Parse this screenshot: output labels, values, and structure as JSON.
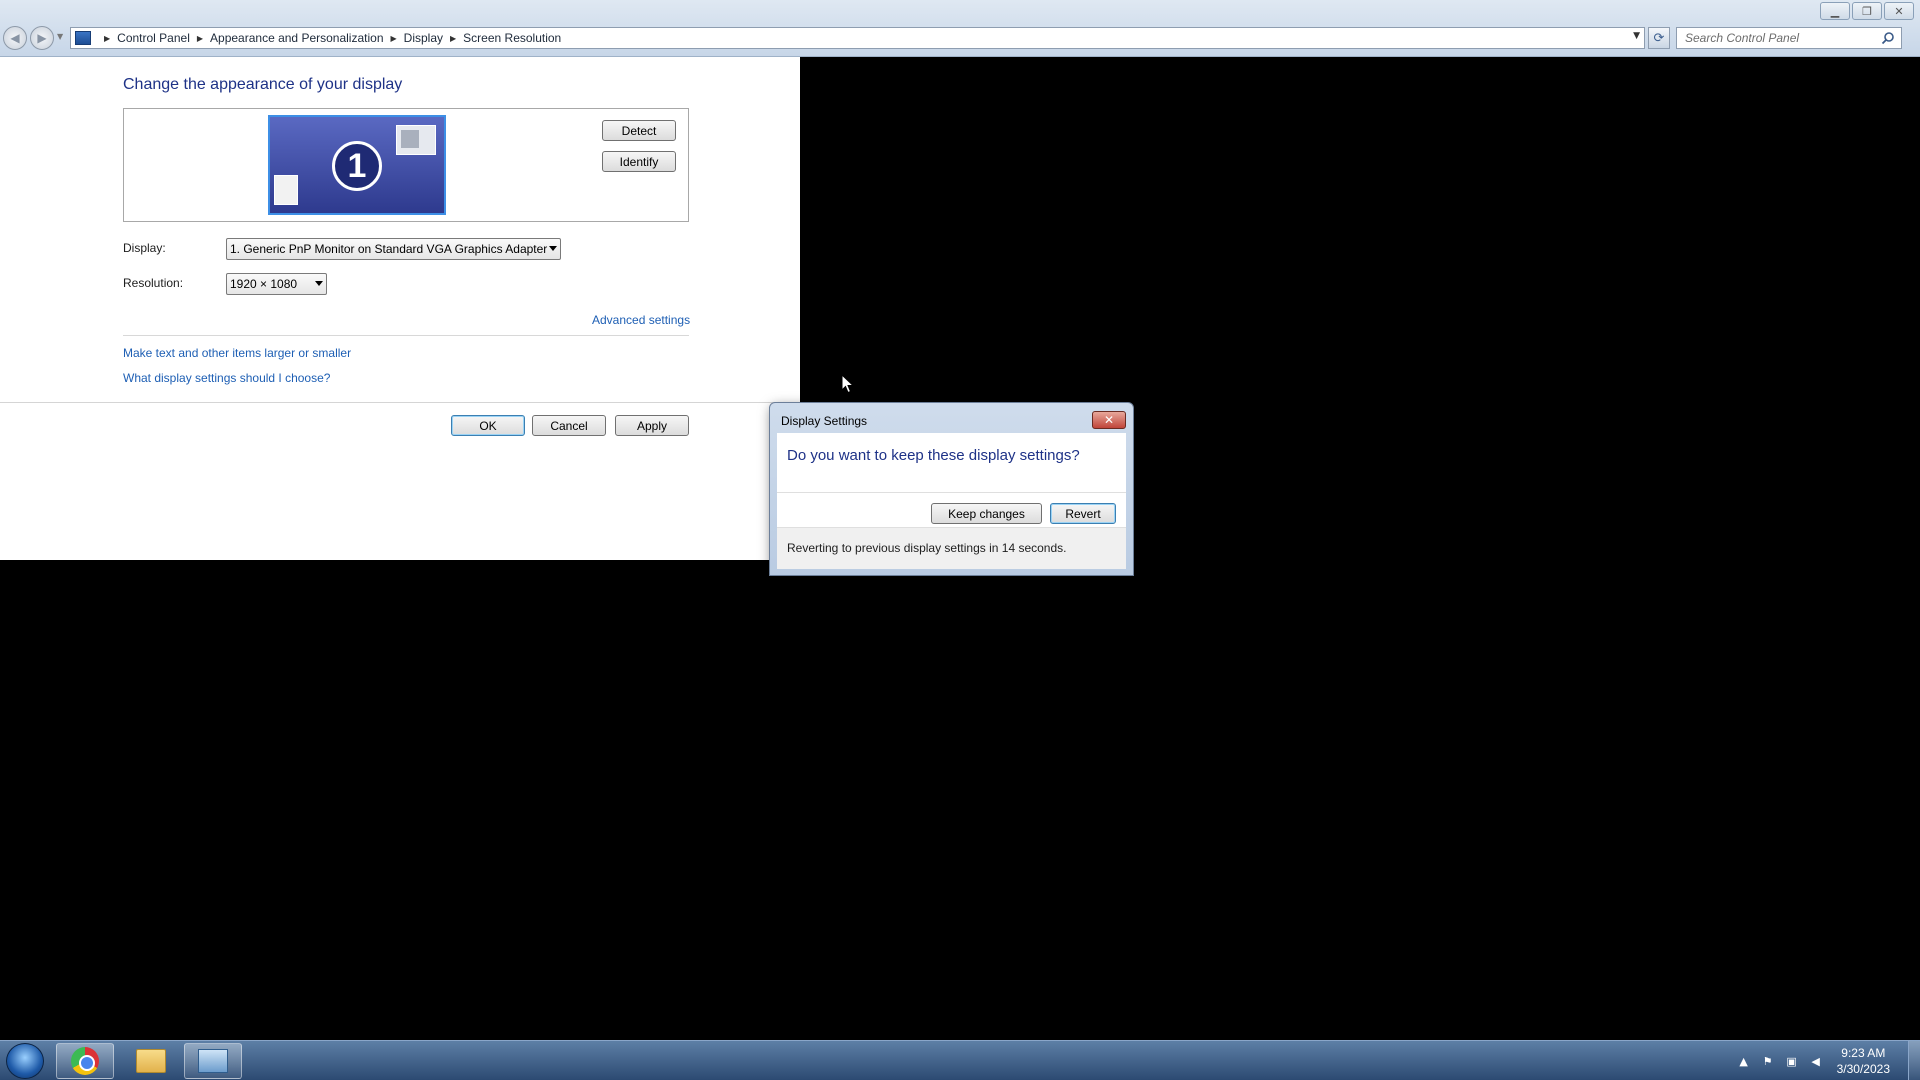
{
  "window": {
    "caption_buttons": [
      "minimize",
      "restore",
      "close"
    ]
  },
  "navigation": {
    "breadcrumbs": [
      "Control Panel",
      "Appearance and Personalization",
      "Display",
      "Screen Resolution"
    ],
    "search_placeholder": "Search Control Panel"
  },
  "main": {
    "title": "Change the appearance of your display",
    "monitor_number": "1",
    "detect_label": "Detect",
    "identify_label": "Identify",
    "display_label": "Display:",
    "display_value": "1. Generic PnP Monitor on Standard VGA Graphics Adapter",
    "resolution_label": "Resolution:",
    "resolution_value": "1920 × 1080",
    "advanced_link": "Advanced settings",
    "link_text_size": "Make text and other items larger or smaller",
    "link_what_settings": "What display settings should I choose?",
    "ok_label": "OK",
    "cancel_label": "Cancel",
    "apply_label": "Apply"
  },
  "dialog": {
    "title": "Display Settings",
    "question": "Do you want to keep these display settings?",
    "keep_label": "Keep changes",
    "revert_label": "Revert",
    "countdown": "Reverting to previous display settings in 14 seconds."
  },
  "taskbar": {
    "apps": [
      "chrome-icon",
      "folder-icon",
      "control-panel-icon"
    ],
    "clock_time": "9:23 AM",
    "clock_date": "3/30/2023"
  },
  "colors": {
    "title_blue": "#1e3287",
    "link_blue": "#1e5fb4"
  }
}
